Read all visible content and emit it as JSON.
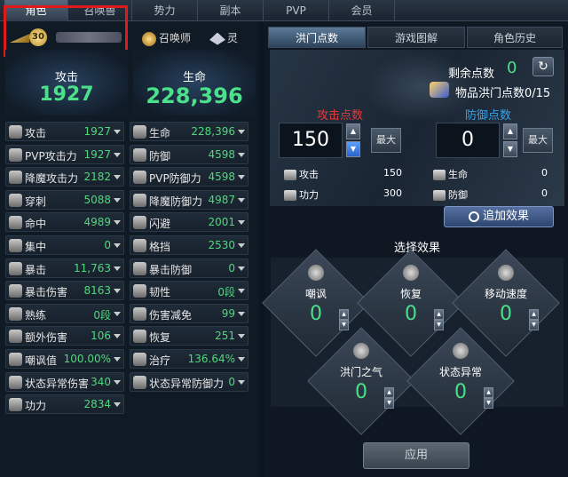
{
  "tabs": [
    "角色",
    "召唤兽",
    "势力",
    "副本",
    "PVP",
    "会员"
  ],
  "char": {
    "level": "30"
  },
  "summon_label": "召唤师",
  "spirit_label": "灵",
  "attack": {
    "label": "攻击",
    "value": "1927"
  },
  "life": {
    "label": "生命",
    "value": "228,396"
  },
  "stats_left": [
    {
      "label": "攻击",
      "value": "1927",
      "icon": "sword-icon"
    },
    {
      "label": "PVP攻击力",
      "value": "1927",
      "icon": "pvp-sword-icon"
    },
    {
      "label": "降魔攻击力",
      "value": "2182",
      "icon": "demon-attack-icon"
    },
    {
      "label": "穿刺",
      "value": "5088",
      "icon": "pierce-icon"
    },
    {
      "label": "命中",
      "value": "4989",
      "icon": "target-icon"
    },
    {
      "label": "集中",
      "value": "0",
      "icon": "focus-icon"
    },
    {
      "label": "暴击",
      "value": "11,763",
      "icon": "critical-icon"
    },
    {
      "label": "暴击伤害",
      "value": "8163",
      "icon": "crit-damage-icon"
    },
    {
      "label": "熟练",
      "value": "0段",
      "icon": "mastery-icon"
    },
    {
      "label": "额外伤害",
      "value": "106",
      "icon": "extra-damage-icon"
    },
    {
      "label": "嘲讽值",
      "value": "100.00%",
      "icon": "taunt-skull-icon"
    },
    {
      "label": "状态异常伤害",
      "value": "340",
      "icon": "status-damage-icon"
    },
    {
      "label": "功力",
      "value": "2834",
      "icon": "power-icon"
    }
  ],
  "stats_right": [
    {
      "label": "生命",
      "value": "228,396",
      "icon": "heart-icon"
    },
    {
      "label": "防御",
      "value": "4598",
      "icon": "shield-icon"
    },
    {
      "label": "PVP防御力",
      "value": "4598",
      "icon": "pvp-shield-icon"
    },
    {
      "label": "降魔防御力",
      "value": "4987",
      "icon": "demon-defense-icon"
    },
    {
      "label": "闪避",
      "value": "2001",
      "icon": "evade-icon"
    },
    {
      "label": "格挡",
      "value": "2530",
      "icon": "block-icon"
    },
    {
      "label": "暴击防御",
      "value": "0",
      "icon": "crit-defense-icon"
    },
    {
      "label": "韧性",
      "value": "0段",
      "icon": "toughness-icon"
    },
    {
      "label": "伤害减免",
      "value": "99",
      "icon": "damage-reduce-icon"
    },
    {
      "label": "恢复",
      "value": "251",
      "icon": "recover-icon"
    },
    {
      "label": "治疗",
      "value": "136.64%",
      "icon": "heal-icon"
    },
    {
      "label": "状态异常防御力",
      "value": "0",
      "icon": "status-defense-icon"
    }
  ],
  "subtabs": [
    "洪门点数",
    "游戏图解",
    "角色历史"
  ],
  "remain": {
    "label": "剩余点数",
    "value": "0"
  },
  "item_label": "物品洪门点数0/15",
  "attack_points": {
    "label": "攻击点数",
    "value": "150",
    "max_label": "最大"
  },
  "defense_points": {
    "label": "防御点数",
    "value": "0",
    "max_label": "最大"
  },
  "effects_left": [
    {
      "label": "攻击",
      "value": "150"
    },
    {
      "label": "功力",
      "value": "300"
    }
  ],
  "effects_right": [
    {
      "label": "生命",
      "value": "0"
    },
    {
      "label": "防御",
      "value": "0"
    }
  ],
  "add_effect_label": "追加效果",
  "select_title": "选择效果",
  "slots": [
    {
      "label": "嘲讽",
      "value": "0"
    },
    {
      "label": "恢复",
      "value": "0"
    },
    {
      "label": "移动速度",
      "value": "0"
    },
    {
      "label": "洪门之气",
      "value": "0"
    },
    {
      "label": "状态异常",
      "value": "0"
    }
  ],
  "apply_label": "应用",
  "colors": {
    "green": "#4be08a",
    "attack_red": "#e33a3a",
    "defense_blue": "#3aa0e6",
    "highlight": "#e0191b"
  }
}
